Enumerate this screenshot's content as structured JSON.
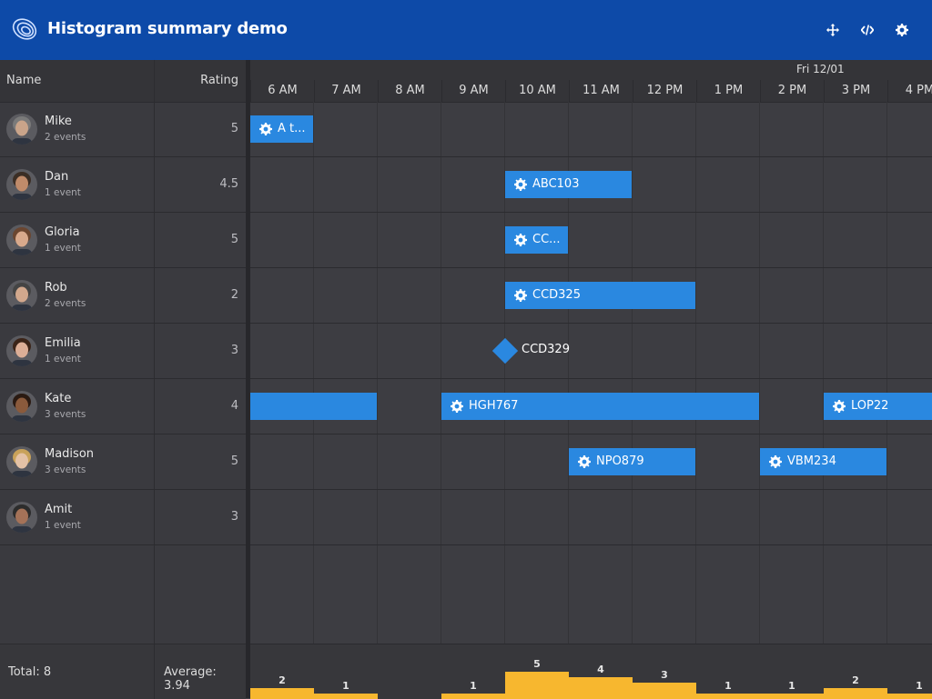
{
  "app": {
    "title": "Histogram summary demo",
    "buttons": [
      {
        "name": "fullscreen-button",
        "icon": "move-arrows-icon"
      },
      {
        "name": "code-button",
        "icon": "code-icon"
      },
      {
        "name": "settings-button",
        "icon": "gear-icon"
      }
    ]
  },
  "columns": {
    "name": "Name",
    "rating": "Rating"
  },
  "resources": [
    {
      "name": "Mike",
      "events": "2 events",
      "rating": "5"
    },
    {
      "name": "Dan",
      "events": "1 event",
      "rating": "4.5"
    },
    {
      "name": "Gloria",
      "events": "1 event",
      "rating": "5"
    },
    {
      "name": "Rob",
      "events": "2 events",
      "rating": "2"
    },
    {
      "name": "Emilia",
      "events": "1 event",
      "rating": "3"
    },
    {
      "name": "Kate",
      "events": "3 events",
      "rating": "4"
    },
    {
      "name": "Madison",
      "events": "3 events",
      "rating": "5"
    },
    {
      "name": "Amit",
      "events": "1 event",
      "rating": "3"
    }
  ],
  "timeline": {
    "date": "Fri 12/01",
    "hours": [
      "6 AM",
      "7 AM",
      "8 AM",
      "9 AM",
      "10 AM",
      "11 AM",
      "12 PM",
      "1 PM",
      "2 PM",
      "3 PM",
      "4 PM"
    ]
  },
  "events": [
    {
      "resource": "Mike",
      "label": "A t...",
      "start": "6:00",
      "end": "7:00",
      "icon": "gear-icon"
    },
    {
      "resource": "Dan",
      "label": "ABC103",
      "start": "10:00",
      "end": "12:00",
      "icon": "gear-icon"
    },
    {
      "resource": "Gloria",
      "label": "CC...",
      "start": "10:00",
      "end": "11:00",
      "icon": "gear-icon"
    },
    {
      "resource": "Rob",
      "label": "CCD325",
      "start": "10:00",
      "end": "13:00",
      "icon": "gear-icon"
    },
    {
      "resource": "Emilia",
      "label": "CCD329",
      "start": "10:00",
      "end": "10:00",
      "milestone": true
    },
    {
      "resource": "Kate",
      "label": "",
      "start": "6:00",
      "end": "8:00",
      "icon": ""
    },
    {
      "resource": "Kate",
      "label": "HGH767",
      "start": "9:00",
      "end": "14:00",
      "icon": "gear-icon"
    },
    {
      "resource": "Kate",
      "label": "LOP22",
      "start": "15:00",
      "end": "17:00",
      "icon": "gear-icon"
    },
    {
      "resource": "Madison",
      "label": "NPO879",
      "start": "11:00",
      "end": "13:00",
      "icon": "gear-icon"
    },
    {
      "resource": "Madison",
      "label": "VBM234",
      "start": "14:00",
      "end": "16:00",
      "icon": "gear-icon"
    }
  ],
  "footer": {
    "total": "Total: 8",
    "average": "Average: 3.94",
    "histogram": [
      {
        "hour": "6 AM",
        "count": 2
      },
      {
        "hour": "7 AM",
        "count": 1
      },
      {
        "hour": "8 AM",
        "count": 0
      },
      {
        "hour": "9 AM",
        "count": 1
      },
      {
        "hour": "10 AM",
        "count": 5
      },
      {
        "hour": "11 AM",
        "count": 4
      },
      {
        "hour": "12 PM",
        "count": 3
      },
      {
        "hour": "1 PM",
        "count": 1
      },
      {
        "hour": "2 PM",
        "count": 1
      },
      {
        "hour": "3 PM",
        "count": 2
      },
      {
        "hour": "4 PM",
        "count": 1
      }
    ]
  },
  "colors": {
    "header": "#0d4aa8",
    "event": "#2a88e0",
    "histogram": "#f7b72f",
    "background": "#3d3d42"
  }
}
